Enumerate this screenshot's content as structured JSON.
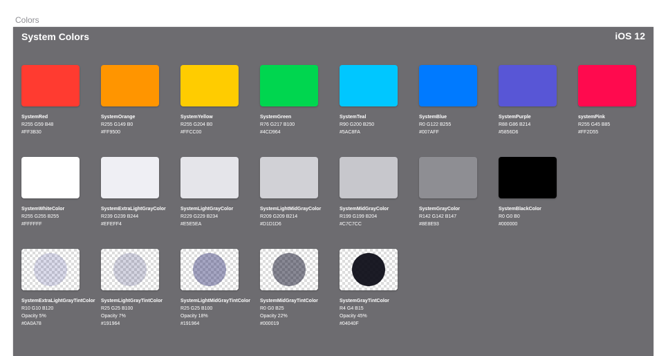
{
  "page_label": "Colors",
  "artboard": {
    "title": "System Colors",
    "version": "iOS 12"
  },
  "rows": [
    [
      {
        "name": "SystemRed",
        "rgb": "R255 G59 B48",
        "hex": "#FF3B30",
        "color": "#FF3B30"
      },
      {
        "name": "SystemOrange",
        "rgb": "R255 G149 B0",
        "hex": "#FF9500",
        "color": "#FF9500"
      },
      {
        "name": "SystemYellow",
        "rgb": "R255 G204 B0",
        "hex": "#FFCC00",
        "color": "#FFCC00"
      },
      {
        "name": "SystemGreen",
        "rgb": "R76 G217 B100",
        "hex": "#4CD964",
        "color": "#00D64F"
      },
      {
        "name": "SystemTeal",
        "rgb": "R90 G200 B250",
        "hex": "#5AC8FA",
        "color": "#00C7FF"
      },
      {
        "name": "SystemBlue",
        "rgb": "R0 G122 B255",
        "hex": "#007AFF",
        "color": "#007AFF"
      },
      {
        "name": "SystemPurple",
        "rgb": "R88 G86 B214",
        "hex": "#5856D6",
        "color": "#5856D6"
      },
      {
        "name": "systemPink",
        "rgb": "R255 G45 B85",
        "hex": "#FF2D55",
        "color": "#FF0A4E"
      }
    ],
    [
      {
        "name": "SystemWhiteColor",
        "rgb": "R255 G255 B255",
        "hex": "#FFFFFF",
        "color": "#FFFFFF"
      },
      {
        "name": "SystemExtraLightGrayColor",
        "rgb": "R239 G239 B244",
        "hex": "#EFEFF4",
        "color": "#EFEFF4"
      },
      {
        "name": "SystemLightGrayColor",
        "rgb": "R229 G229 B234",
        "hex": "#E5E5EA",
        "color": "#E5E5EA"
      },
      {
        "name": "SystemLightMidGrayColor",
        "rgb": "R209 G209 B214",
        "hex": "#D1D1D6",
        "color": "#D1D1D6"
      },
      {
        "name": "SystemMidGrayColor",
        "rgb": "R199 G199 B204",
        "hex": "#C7C7CC",
        "color": "#C7C7CC"
      },
      {
        "name": "SystemGrayColor",
        "rgb": "R142 G142 B147",
        "hex": "#8E8E93",
        "color": "#8E8E93"
      },
      {
        "name": "SystemBlackColor",
        "rgb": "R0 G0 B0",
        "hex": "#000000",
        "color": "#000000"
      }
    ],
    [
      {
        "name": "SystemExtraLightGrayTintColor",
        "rgb": "R10 G10 B120",
        "opacity": "Opacity 5%",
        "hex": "#0A0A78",
        "color": "#0A0A78",
        "alpha": 0.05
      },
      {
        "name": "SystemLightGrayTintColor",
        "rgb": "R25 G25 B100",
        "opacity": "Opacity 7%",
        "hex": "#191964",
        "color": "#191964",
        "alpha": 0.07
      },
      {
        "name": "SystemLightMidGrayTintColor",
        "rgb": "R25 G25 B100",
        "opacity": "Opacity 18%",
        "hex": "#191964",
        "color": "#191964",
        "alpha": 0.18
      },
      {
        "name": "SystemMidGrayTintColor",
        "rgb": "R0 G0 B25",
        "opacity": "Opacity 22%",
        "hex": "#000019",
        "color": "#000019",
        "alpha": 0.22
      },
      {
        "name": "SystemGrayTintColor",
        "rgb": "R4 G4 B15",
        "opacity": "Opacity 45%",
        "hex": "#04040F",
        "color": "#04040F",
        "alpha": 0.45
      }
    ]
  ]
}
